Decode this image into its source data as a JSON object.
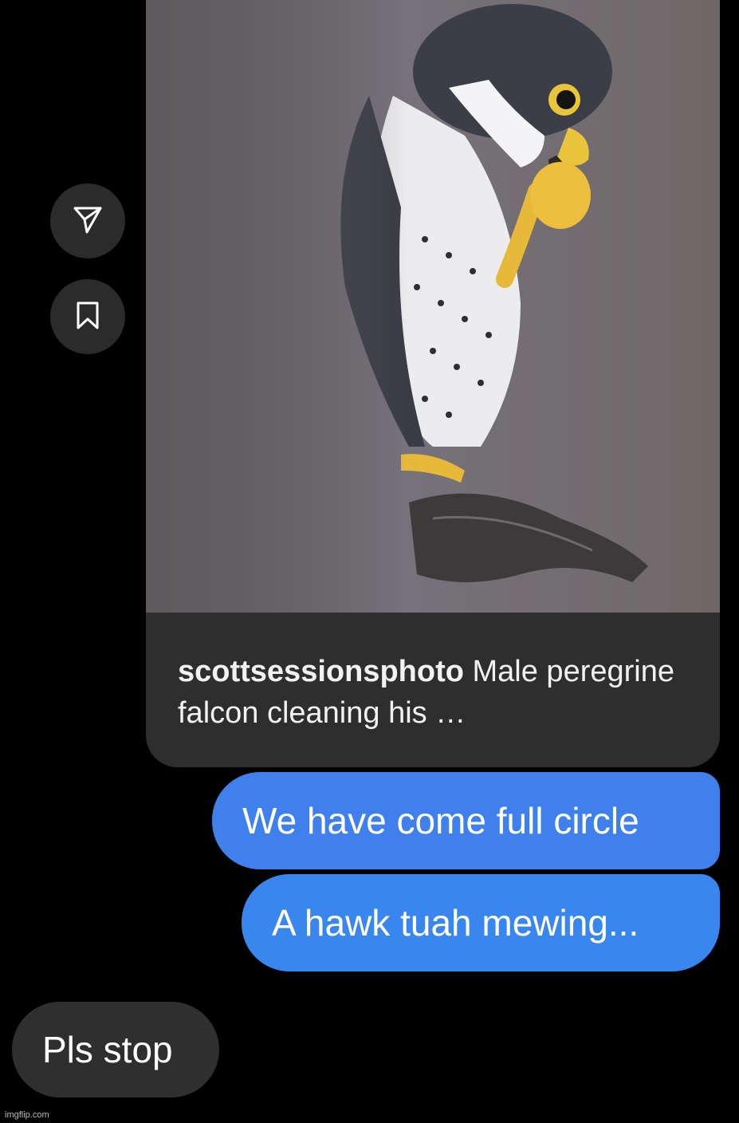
{
  "actions": {
    "share_icon": "paper-plane-icon",
    "save_icon": "bookmark-icon"
  },
  "post": {
    "username": "scottsessionsphoto",
    "caption_text": " Male peregrine falcon cleaning his …",
    "image_icon": "falcon-photo"
  },
  "messages": [
    {
      "text": "We have come full circle",
      "direction": "sent"
    },
    {
      "text": "A hawk tuah mewing...",
      "direction": "sent"
    },
    {
      "text": "Pls stop",
      "direction": "received"
    }
  ],
  "watermark": "imgflip.com",
  "colors": {
    "sent_bubble": "#3f80ec",
    "received_bubble": "#2f2f2f",
    "background": "#000000"
  }
}
